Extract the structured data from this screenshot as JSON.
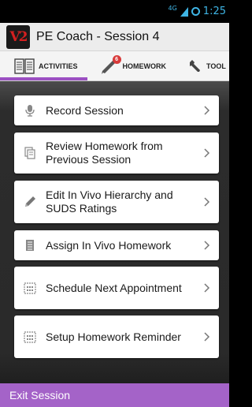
{
  "status_bar": {
    "network": "4G",
    "time": "1:25"
  },
  "app": {
    "logo_text": "V2",
    "title": "PE Coach - Session 4"
  },
  "tabs": [
    {
      "label": "ACTIVITIES",
      "icon": "book-icon"
    },
    {
      "label": "HOMEWORK",
      "icon": "pencil-icon",
      "badge": "6"
    },
    {
      "label": "TOOL",
      "icon": "wrench-icon"
    }
  ],
  "menu": [
    {
      "label": "Record Session",
      "icon": "microphone-icon"
    },
    {
      "label": "Review Homework from Previous Session",
      "icon": "documents-icon"
    },
    {
      "label": "Edit In Vivo Hierarchy and SUDS Ratings",
      "icon": "pencil-icon"
    },
    {
      "label": "Assign In Vivo Homework",
      "icon": "list-icon"
    },
    {
      "label": "Schedule Next Appointment",
      "icon": "calendar-icon"
    },
    {
      "label": "Setup Homework Reminder",
      "icon": "calendar-icon"
    }
  ],
  "footer": {
    "exit_label": "Exit Session"
  },
  "colors": {
    "accent": "#a463c8",
    "status": "#3fb5e5",
    "badge": "#d83a3a"
  }
}
